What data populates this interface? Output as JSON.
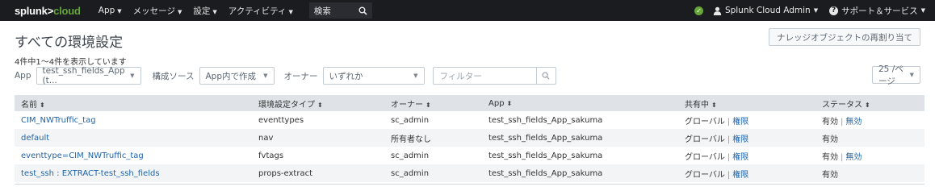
{
  "nav": {
    "logo_brand": "splunk>",
    "logo_suffix": "cloud",
    "menu": [
      "App",
      "メッセージ",
      "設定",
      "アクティビティ"
    ],
    "search_label": "検索",
    "user": "Splunk Cloud Admin",
    "help": "サポート＆サービス"
  },
  "header": {
    "title": "すべての環境設定",
    "reassign_button": "ナレッジオブジェクトの再割り当て",
    "count_text": "4件中1〜4件を表示しています"
  },
  "filters": {
    "app_label": "App",
    "app_value": "test_ssh_fields_App (t...",
    "source_label": "構成ソース",
    "source_value": "App内で作成",
    "owner_label": "オーナー",
    "owner_value": "いずれか",
    "filter_placeholder": "フィルター",
    "per_page": "25 /ページ"
  },
  "table": {
    "columns": [
      "名前",
      "環境設定タイプ",
      "オーナー",
      "App",
      "共有中",
      "ステータス"
    ],
    "rows": [
      {
        "name": "CIM_NWTruffic_tag",
        "type": "eventtypes",
        "owner": "sc_admin",
        "app": "test_ssh_fields_App_sakuma",
        "sharing": "グローバル",
        "perm": "権限",
        "status": "有効",
        "status_action": "無効"
      },
      {
        "name": "default",
        "type": "nav",
        "owner": "所有者なし",
        "app": "test_ssh_fields_App_sakuma",
        "sharing": "グローバル",
        "perm": "権限",
        "status": "有効",
        "status_action": ""
      },
      {
        "name": "eventtype=CIM_NWTruffic_tag",
        "type": "fvtags",
        "owner": "sc_admin",
        "app": "test_ssh_fields_App_sakuma",
        "sharing": "グローバル",
        "perm": "権限",
        "status": "有効",
        "status_action": "無効"
      },
      {
        "name": "test_ssh : EXTRACT-test_ssh_fields",
        "type": "props-extract",
        "owner": "sc_admin",
        "app": "test_ssh_fields_App_sakuma",
        "sharing": "グローバル",
        "perm": "権限",
        "status": "有効",
        "status_action": ""
      }
    ]
  },
  "colors": {
    "nav_bg": "#1a1c20",
    "accent_green": "#65a637",
    "link_blue": "#1e63a8",
    "header_row_bg": "#dfe3e8"
  }
}
